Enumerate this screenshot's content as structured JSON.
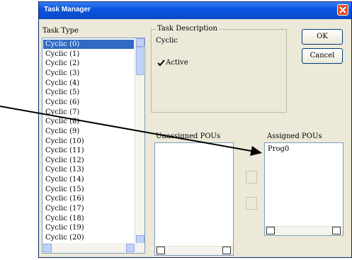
{
  "window": {
    "title": "Task Manager"
  },
  "task_type": {
    "label": "Task Type",
    "items": [
      "Cyclic (0)",
      "Cyclic (1)",
      "Cyclic (2)",
      "Cyclic (3)",
      "Cyclic (4)",
      "Cyclic (5)",
      "Cyclic (6)",
      "Cyclic (7)",
      "Cyclic (8)",
      "Cyclic (9)",
      "Cyclic (10)",
      "Cyclic (11)",
      "Cyclic (12)",
      "Cyclic (13)",
      "Cyclic (14)",
      "Cyclic (15)",
      "Cyclic (16)",
      "Cyclic (17)",
      "Cyclic (18)",
      "Cyclic (19)",
      "Cyclic (20)"
    ],
    "selected_index": 0
  },
  "task_description": {
    "label": "Task Description",
    "value": "Cyclic",
    "active_label": "Active",
    "active_checked": true
  },
  "buttons": {
    "ok": "OK",
    "cancel": "Cancel"
  },
  "unassigned": {
    "label": "Unassigned POUs",
    "items": []
  },
  "assigned": {
    "label": "Assigned POUs",
    "items": [
      "Prog0"
    ]
  },
  "colors": {
    "titlebar": "#0a54e0",
    "selection": "#316ac5",
    "close": "#e04a1f",
    "annotation_arrow": "#000000"
  }
}
